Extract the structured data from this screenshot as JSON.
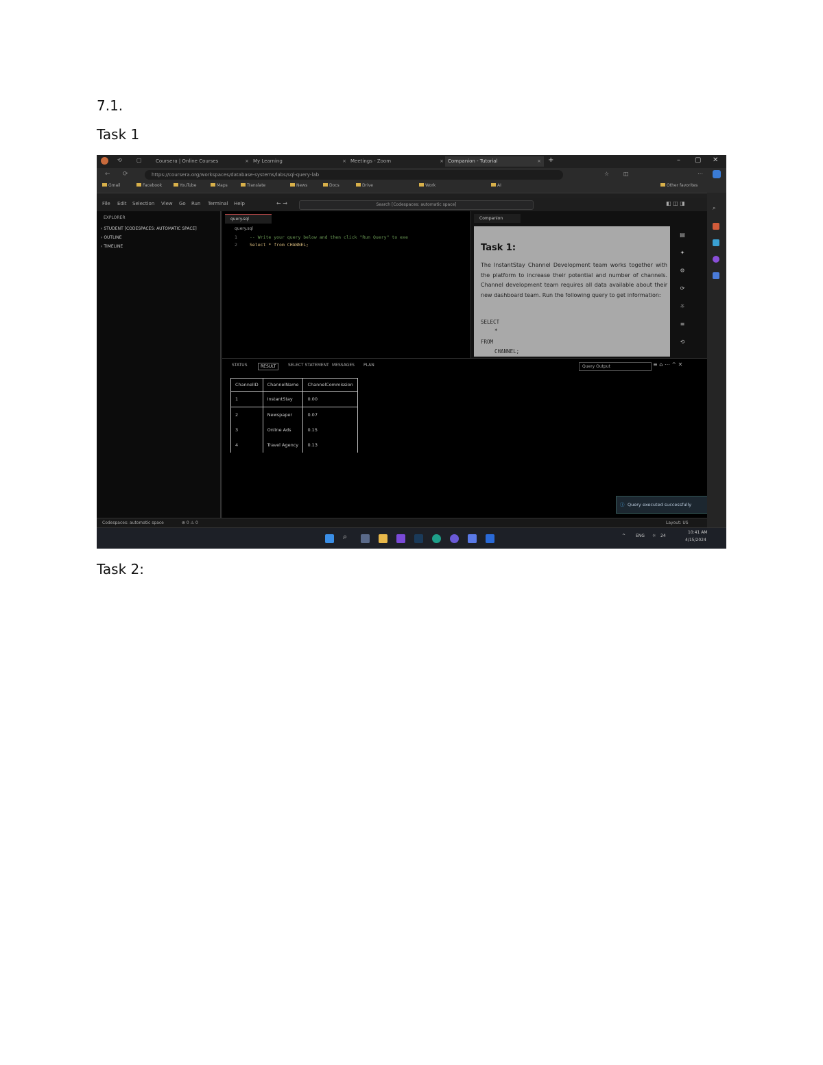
{
  "document": {
    "heading": "7.1.",
    "task1_label": "Task 1",
    "task2_label": "Task 2:"
  },
  "browser": {
    "tabs": [
      "Coursera | Online Courses",
      "My Learning",
      "Meetings - Zoom",
      "Companion - Tutorial"
    ],
    "url": "https://coursera.org/workspaces/database-systems/labs/sql-query-lab",
    "bookmarks": [
      "Gmail",
      "Facebook",
      "YouTube",
      "Maps",
      "Translate",
      "News",
      "Docs",
      "Drive",
      "Work",
      "AI",
      "Other favorites"
    ]
  },
  "vscode": {
    "menu": [
      "File",
      "Edit",
      "Selection",
      "View",
      "Go",
      "Run",
      "Terminal",
      "Help"
    ],
    "search_placeholder": "Search [Codespaces: automatic space]",
    "sidebar_title": "EXPLORER",
    "sidebar_items": [
      "STUDENT [CODESPACES: AUTOMATIC SPACE]",
      "OUTLINE",
      "TIMELINE"
    ],
    "editor_tab": "query.sql",
    "breadcrumb": "query.sql",
    "code_lines": [
      "-- Write your query below and then click \"Run Query\" to exe",
      "Select * from CHANNEL;"
    ],
    "companion_tab": "Companion",
    "instructions_title": "Task 1:",
    "instructions_text": "The InstantStay Channel Development team works together with the platform to increase their potential and number of channels. Channel development team requires all data available about their new dashboard team. Run the following query to get information:",
    "sql_lines": [
      "SELECT",
      "*",
      "FROM",
      "CHANNEL;"
    ],
    "results_tabs": [
      "STATUS",
      "RESULT",
      "SELECT STATEMENT",
      "MESSAGES",
      "PLAN"
    ],
    "output_select": "Query Output",
    "table": {
      "columns": [
        "ChannelID",
        "ChannelName",
        "ChannelCommission"
      ],
      "rows": [
        [
          "1",
          "InstantStay",
          "0.00"
        ],
        [
          "2",
          "Newspaper",
          "0.07"
        ],
        [
          "3",
          "Online Ads",
          "0.15"
        ],
        [
          "4",
          "Travel Agency",
          "0.13"
        ]
      ]
    },
    "toast": "Query executed successfully",
    "status_left": "Codespaces: automatic space",
    "status_right": "Layout: US"
  },
  "taskbar": {
    "language": "ENG",
    "temperature": "24",
    "time": "10:41 AM",
    "date": "4/15/2024"
  }
}
